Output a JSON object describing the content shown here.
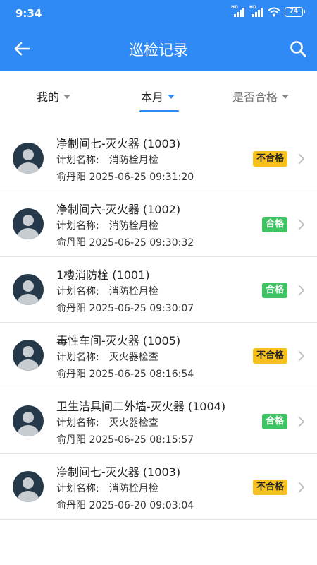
{
  "status_bar": {
    "time": "9:34",
    "battery": "74",
    "signal_label": "HD"
  },
  "header": {
    "title": "巡检记录",
    "back_icon": "arrow-left-icon",
    "search_icon": "search-icon"
  },
  "colors": {
    "primary": "#2f8af5",
    "pass": "#3ec463",
    "fail": "#f6c11c"
  },
  "filters": [
    {
      "label": "我的",
      "active": false
    },
    {
      "label": "本月",
      "active": true
    },
    {
      "label": "是否合格",
      "active": false
    }
  ],
  "plan_label": "计划名称:",
  "records": [
    {
      "title": "净制间七-灭火器 (1003)",
      "plan": "消防栓月检",
      "inspector": "俞丹阳",
      "time": "2025-06-25 09:31:20",
      "status": "不合格",
      "status_type": "fail"
    },
    {
      "title": "净制间六-灭火器 (1002)",
      "plan": "消防栓月检",
      "inspector": "俞丹阳",
      "time": "2025-06-25 09:30:32",
      "status": "合格",
      "status_type": "pass"
    },
    {
      "title": "1楼消防栓 (1001)",
      "plan": "消防栓月检",
      "inspector": "俞丹阳",
      "time": "2025-06-25 09:30:07",
      "status": "合格",
      "status_type": "pass"
    },
    {
      "title": "毒性车间-灭火器 (1005)",
      "plan": "灭火器检查",
      "inspector": "俞丹阳",
      "time": "2025-06-25 08:16:54",
      "status": "不合格",
      "status_type": "fail"
    },
    {
      "title": "卫生洁具间二外墙-灭火器 (1004)",
      "plan": "灭火器检查",
      "inspector": "俞丹阳",
      "time": "2025-06-25 08:15:57",
      "status": "合格",
      "status_type": "pass"
    },
    {
      "title": "净制间七-灭火器 (1003)",
      "plan": "消防栓月检",
      "inspector": "俞丹阳",
      "time": "2025-06-20 09:03:04",
      "status": "不合格",
      "status_type": "fail"
    }
  ]
}
